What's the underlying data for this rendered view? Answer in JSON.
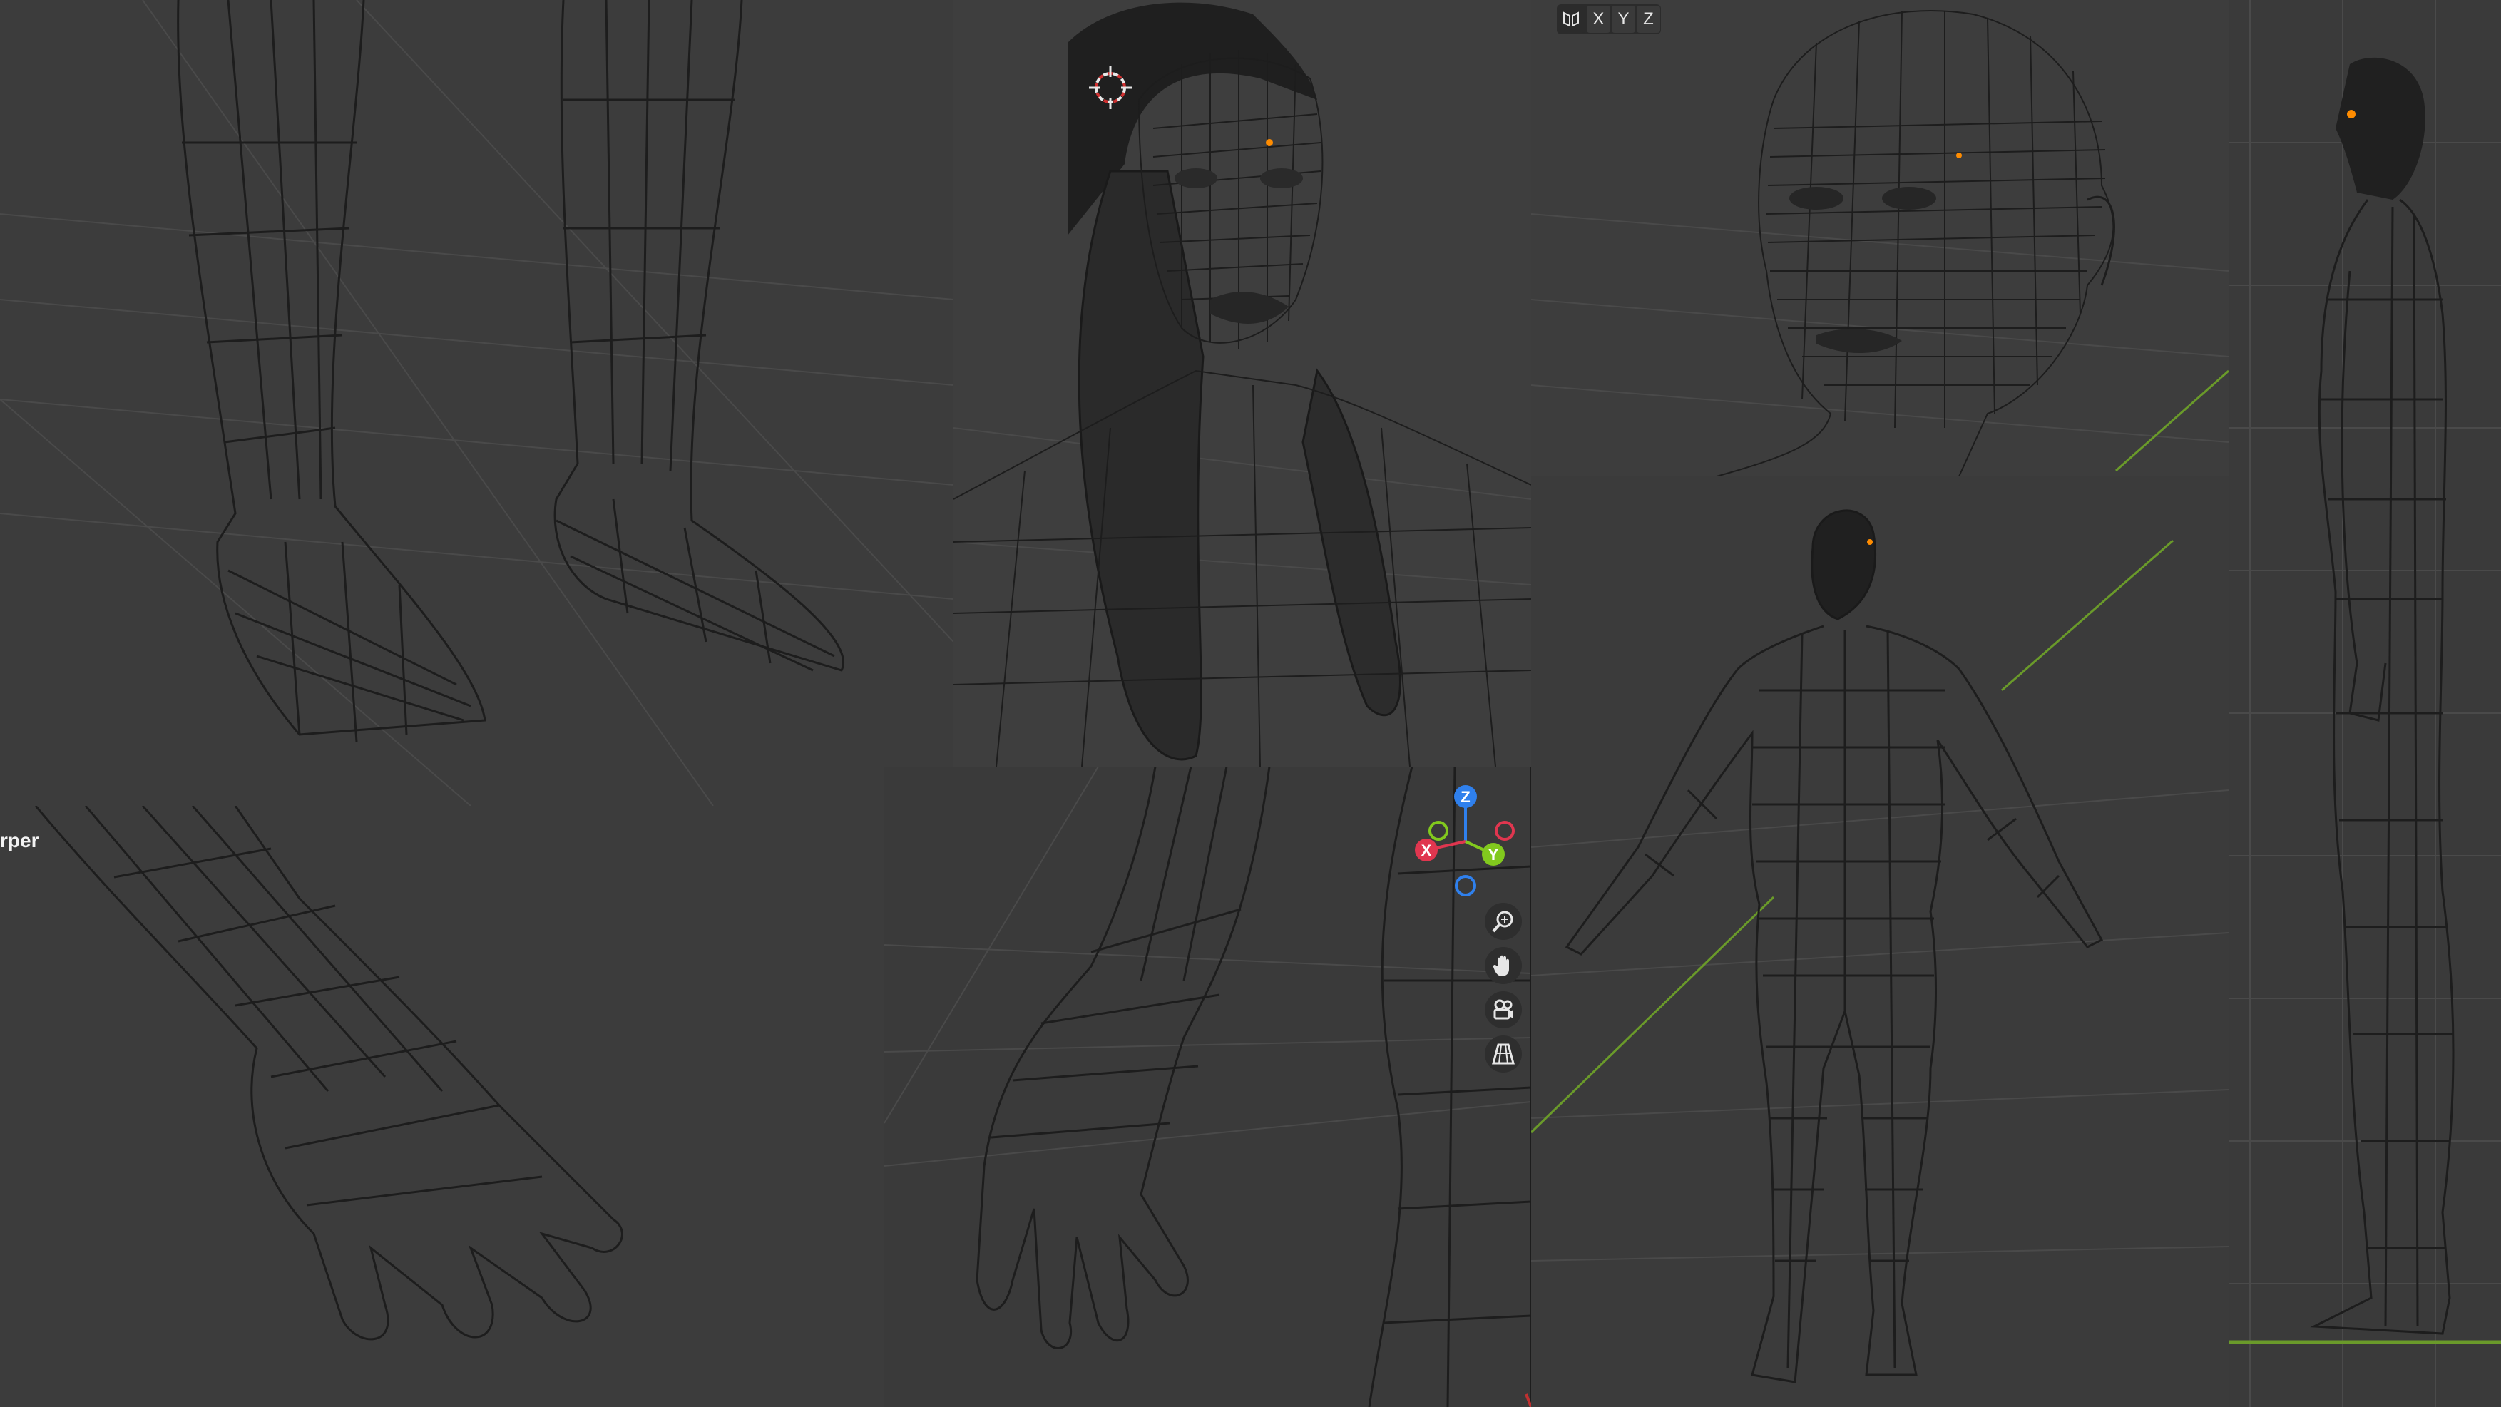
{
  "viewport": {
    "mode_label": "rper",
    "axis_buttons": [
      "X",
      "Y",
      "Z"
    ],
    "gizmo": {
      "z": "Z",
      "x": "X",
      "y": "Y"
    },
    "nav_tools": [
      "zoom-icon",
      "pan-hand-icon",
      "camera-icon",
      "grid-perspective-icon"
    ]
  },
  "colors": {
    "background": "#3d3d3d",
    "wire": "#1d1d1d",
    "axis_x": "#e0364f",
    "axis_y": "#82c91e",
    "axis_z": "#2f80ed",
    "selected_vertex": "#ff8c00",
    "ground_line": "#6a9a2a"
  }
}
